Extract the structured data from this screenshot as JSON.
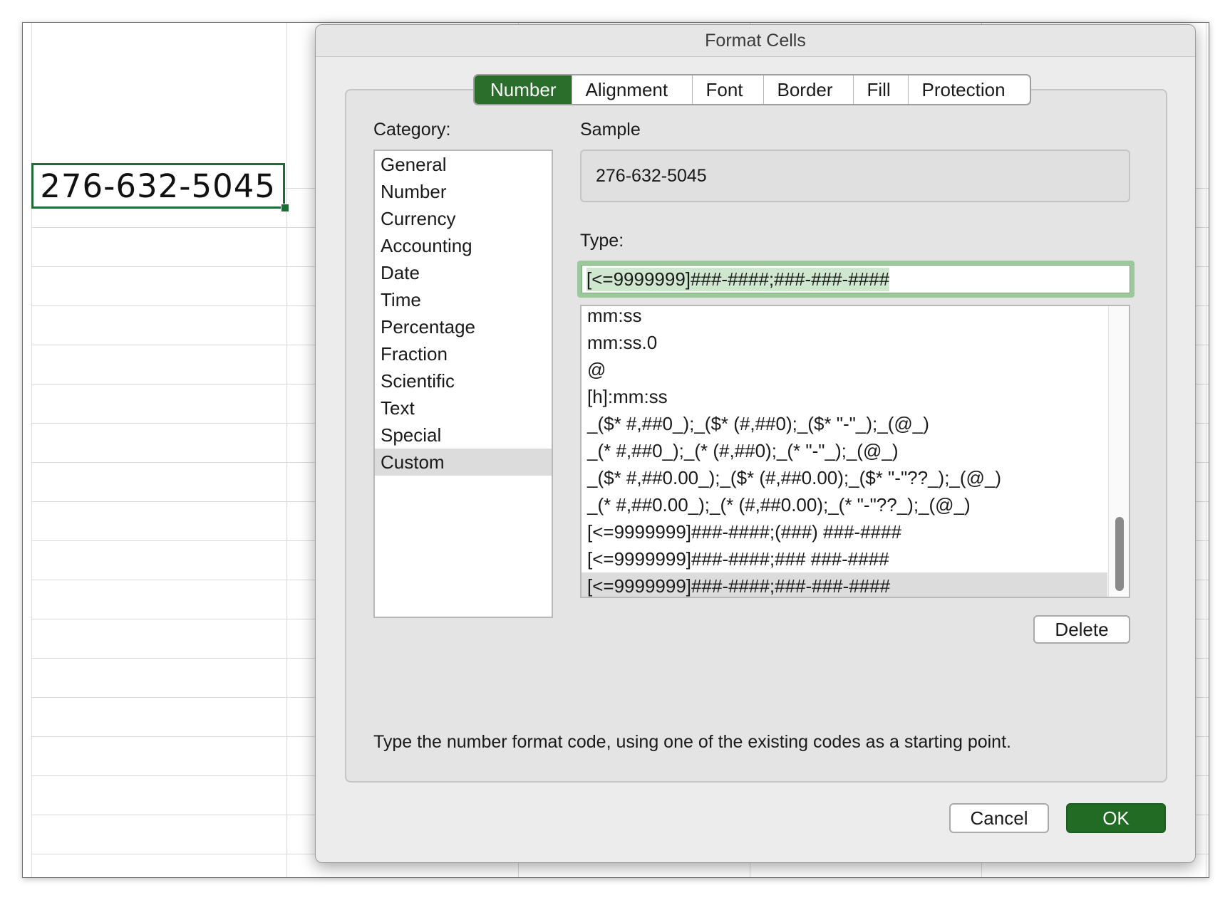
{
  "sheet": {
    "active_cell_value": "276-632-5045"
  },
  "dialog": {
    "title": "Format Cells",
    "tabs": [
      {
        "label": "Number",
        "active": true
      },
      {
        "label": "Alignment",
        "active": false
      },
      {
        "label": "Font",
        "active": false
      },
      {
        "label": "Border",
        "active": false
      },
      {
        "label": "Fill",
        "active": false
      },
      {
        "label": "Protection",
        "active": false
      }
    ],
    "category_label": "Category:",
    "categories": [
      "General",
      "Number",
      "Currency",
      "Accounting",
      "Date",
      "Time",
      "Percentage",
      "Fraction",
      "Scientific",
      "Text",
      "Special",
      "Custom"
    ],
    "selected_category": "Custom",
    "sample_label": "Sample",
    "sample_value": "276-632-5045",
    "type_label": "Type:",
    "type_value": "[<=9999999]###-####;###-###-####",
    "formats": [
      "mm:ss",
      "mm:ss.0",
      "@",
      "[h]:mm:ss",
      "_($* #,##0_);_($* (#,##0);_($* \"-\"_);_(@_)",
      "_(* #,##0_);_(* (#,##0);_(* \"-\"_);_(@_)",
      "_($* #,##0.00_);_($* (#,##0.00);_($* \"-\"??_);_(@_)",
      "_(* #,##0.00_);_(* (#,##0.00);_(* \"-\"??_);_(@_)",
      "[<=9999999]###-####;(###) ###-####",
      "[<=9999999]###-####;### ###-####",
      "[<=9999999]###-####;###-###-####"
    ],
    "selected_format_index": 10,
    "delete_label": "Delete",
    "hint": "Type the number format code, using one of the existing codes as a starting point.",
    "cancel_label": "Cancel",
    "ok_label": "OK",
    "colors": {
      "accent": "#226b24",
      "selection": "#dcdcdc",
      "input_focus": "#9cc99c"
    }
  }
}
